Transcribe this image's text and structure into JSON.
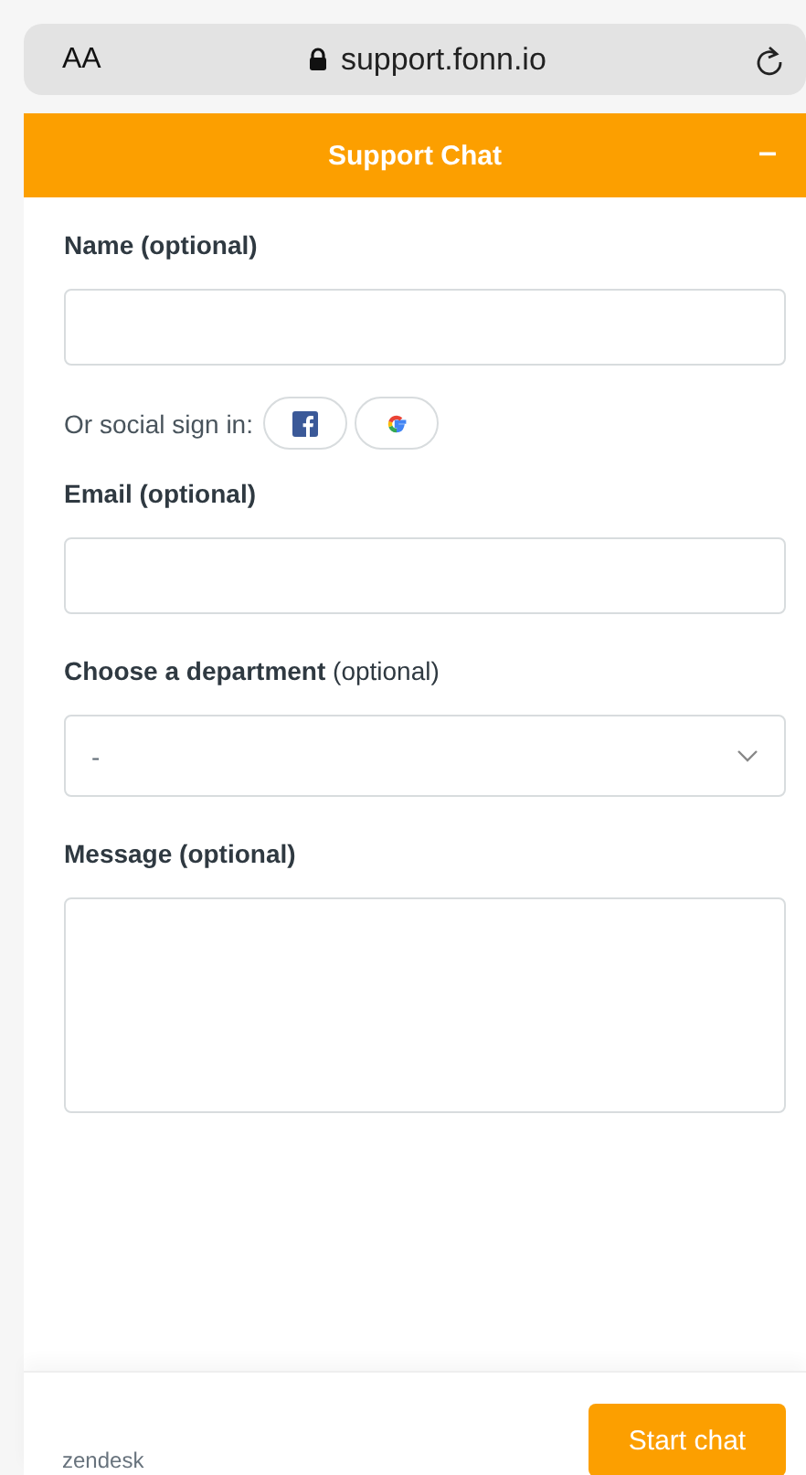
{
  "browser": {
    "text_size": "AA",
    "url": "support.fonn.io"
  },
  "header": {
    "title": "Support Chat",
    "minimize": "–"
  },
  "form": {
    "fields": [
      {
        "kind": "input",
        "label": "Name (optional)"
      },
      {
        "kind": "social",
        "label": "Or social sign in:"
      },
      {
        "kind": "input",
        "label": "Email (optional)"
      },
      {
        "kind": "select",
        "label": "**Choose a department** (optional)",
        "value": "-"
      },
      {
        "kind": "textarea",
        "label": "Message (optional)"
      }
    ]
  },
  "footer": {
    "brand": "zendesk",
    "button": "Start chat"
  }
}
